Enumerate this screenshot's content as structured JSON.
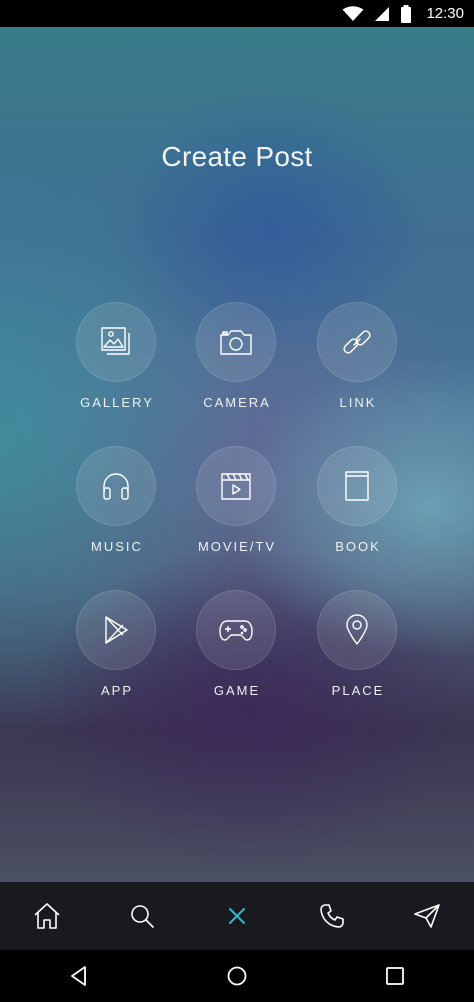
{
  "status_bar": {
    "time": "12:30",
    "icons": [
      "wifi-icon",
      "signal-icon",
      "battery-icon"
    ]
  },
  "screen": {
    "title": "Create Post",
    "options": [
      {
        "label": "GALLERY",
        "icon": "gallery-icon"
      },
      {
        "label": "CAMERA",
        "icon": "camera-icon"
      },
      {
        "label": "LINK",
        "icon": "link-icon"
      },
      {
        "label": "MUSIC",
        "icon": "headphones-icon"
      },
      {
        "label": "MOVIE/TV",
        "icon": "clapperboard-icon"
      },
      {
        "label": "BOOK",
        "icon": "book-icon"
      },
      {
        "label": "APP",
        "icon": "play-store-icon"
      },
      {
        "label": "GAME",
        "icon": "gamepad-icon"
      },
      {
        "label": "PLACE",
        "icon": "location-pin-icon"
      }
    ]
  },
  "bottom_nav": {
    "items": [
      "home-icon",
      "search-icon",
      "close-icon",
      "phone-icon",
      "send-icon"
    ],
    "active": "close-icon",
    "active_color": "#2fb8c9"
  },
  "system_nav": {
    "items": [
      "back-icon",
      "home-circle-icon",
      "recents-icon"
    ]
  }
}
